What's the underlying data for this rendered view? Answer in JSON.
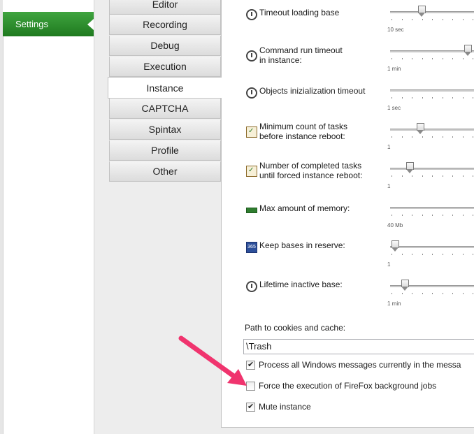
{
  "sidebar": {
    "settings_label": "Settings"
  },
  "tabs": [
    {
      "label": "Editor",
      "active": false
    },
    {
      "label": "Recording",
      "active": false
    },
    {
      "label": "Debug",
      "active": false
    },
    {
      "label": "Execution",
      "active": false
    },
    {
      "label": "Instance",
      "active": true
    },
    {
      "label": "CAPTCHA",
      "active": false
    },
    {
      "label": "Spintax",
      "active": false
    },
    {
      "label": "Profile",
      "active": false
    },
    {
      "label": "Other",
      "active": false
    }
  ],
  "settings": [
    {
      "icon": "clock-icon",
      "line1": "Timeout loading base",
      "line2": "",
      "min_label": "10 sec",
      "level": 0.35
    },
    {
      "icon": "clock-icon",
      "line1": "Command run timeout",
      "line2": "in instance:",
      "min_label": "1 min",
      "level": 0.93
    },
    {
      "icon": "clock-icon",
      "line1": "Objects inizialization timeout",
      "line2": "",
      "min_label": "1 sec",
      "level": null
    },
    {
      "icon": "clipboard-check-icon",
      "line1": "Minimum count of tasks",
      "line2": "before instance reboot:",
      "min_label": "1",
      "level": 0.33
    },
    {
      "icon": "clipboard-check-icon",
      "line1": "Number of completed tasks",
      "line2": "until forced instance reboot:",
      "min_label": "1",
      "level": 0.2
    },
    {
      "icon": "memory-icon",
      "line1": "Max amount of memory:",
      "line2": "",
      "min_label": "40 Mb",
      "level": null
    },
    {
      "icon": "database-icon",
      "line1": "Keep bases in reserve:",
      "line2": "",
      "min_label": "1",
      "level": 0.02
    },
    {
      "icon": "clock-icon",
      "line1": "Lifetime inactive base:",
      "line2": "",
      "min_label": "1 min",
      "level": 0.14
    }
  ],
  "cookies": {
    "label": "Path to cookies and cache:",
    "value": "\\Trash"
  },
  "checkboxes": [
    {
      "label": "Process all Windows messages currently in the messa",
      "checked": true
    },
    {
      "label": "Force the execution of FireFox background jobs",
      "checked": false
    },
    {
      "label": "Mute instance",
      "checked": true
    }
  ],
  "colors": {
    "sidebar_accent": "#2e8b2e",
    "annotation_arrow": "#f0346e"
  }
}
